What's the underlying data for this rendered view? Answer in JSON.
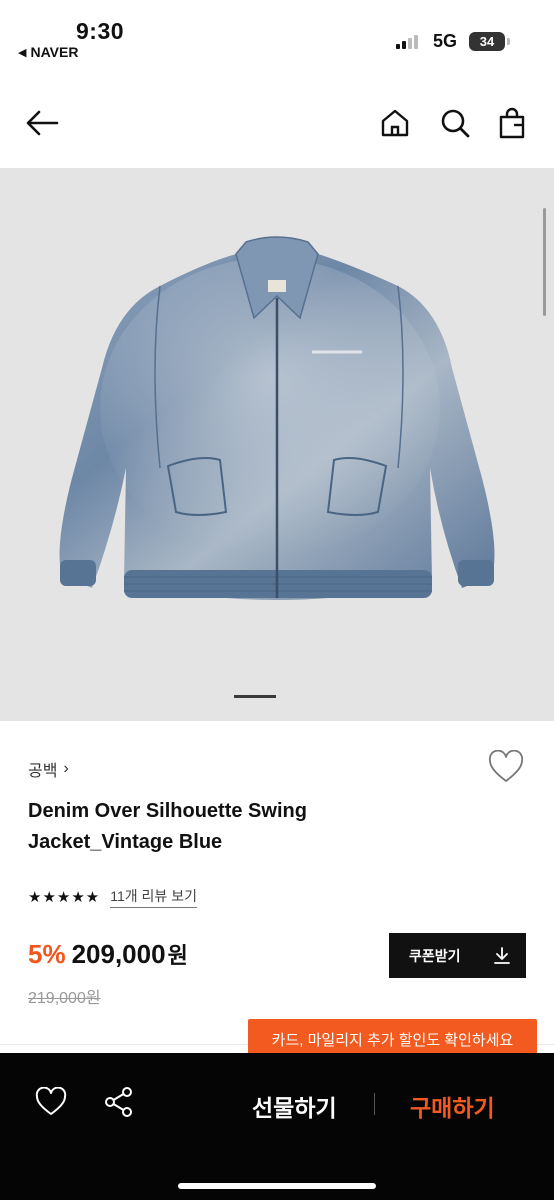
{
  "status": {
    "time": "9:30",
    "back_app": "NAVER",
    "network": "5G",
    "battery": "34"
  },
  "nav": {
    "icons": [
      "back-arrow-icon",
      "home-icon",
      "search-icon",
      "shopping-bag-icon"
    ]
  },
  "product": {
    "brand": "공백",
    "brand_chevron": "›",
    "title": "Denim Over Silhouette Swing Jacket_Vintage Blue",
    "rating_stars": "★★★★★",
    "rating_value": 5,
    "review_link": "11개 리뷰 보기",
    "discount": "5%",
    "price": "209,000",
    "currency": "원",
    "original_price": "219,000원",
    "image_count": 1
  },
  "coupon_button": {
    "label": "쿠폰받기"
  },
  "promo_banner": {
    "text": "카드, 마일리지 추가 할인도 확인하세요"
  },
  "bottom_bar": {
    "gift_label": "선물하기",
    "buy_label": "구매하기"
  },
  "colors": {
    "accent": "#f25a1f",
    "dark": "#050505",
    "image_bg": "#e4e4e4"
  }
}
